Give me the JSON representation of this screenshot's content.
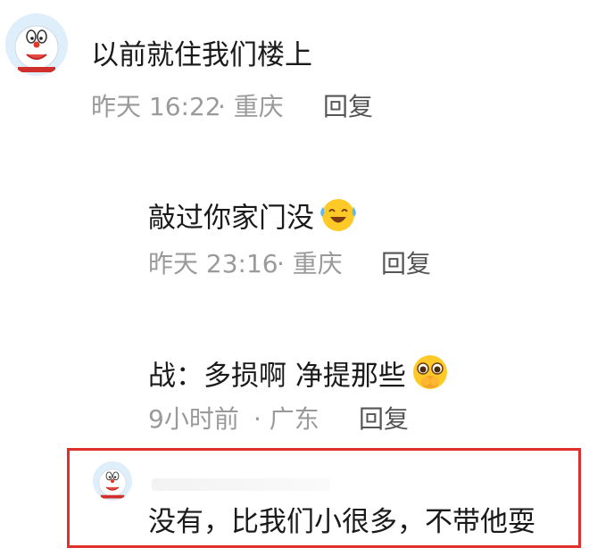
{
  "comments": [
    {
      "text": "以前就住我们楼上",
      "time": "昨天 16:22",
      "location": "· 重庆",
      "reply_label": "回复"
    },
    {
      "text": "敲过你家门没",
      "emoji": "laughing-crying-emoji",
      "time": "昨天 23:16",
      "location": "· 重庆",
      "reply_label": "回复"
    },
    {
      "text": "战：多损啊 净提那些",
      "emoji": "shy-blushing-emoji",
      "time": "9小时前",
      "location": "· 广东",
      "reply_label": "回复"
    },
    {
      "text": "没有，比我们小很多，不带他耍"
    }
  ],
  "colors": {
    "text": "#1a1a1a",
    "meta": "#9a9a9a",
    "reply": "#555555",
    "highlight_border": "#e0302b",
    "emoji_face": "#ffc928"
  }
}
